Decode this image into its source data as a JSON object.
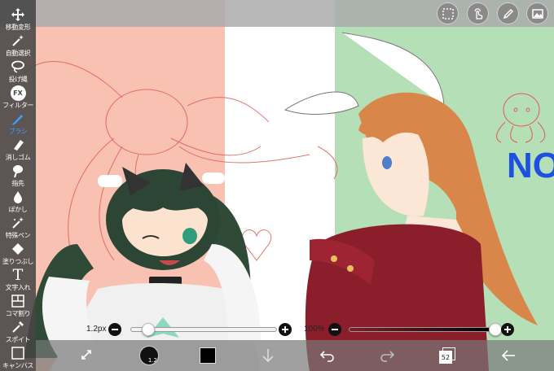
{
  "tools": [
    {
      "label": "移動変形",
      "icon": "move-icon"
    },
    {
      "label": "自動選択",
      "icon": "magic-wand-icon"
    },
    {
      "label": "投げ縄",
      "icon": "lasso-icon"
    },
    {
      "label": "フィルター",
      "icon": "fx-icon",
      "icon_text": "FX"
    },
    {
      "label": "ブラシ",
      "icon": "brush-icon",
      "active": true
    },
    {
      "label": "消しゴム",
      "icon": "eraser-icon"
    },
    {
      "label": "指先",
      "icon": "smudge-icon"
    },
    {
      "label": "ぼかし",
      "icon": "blur-drop-icon"
    },
    {
      "label": "特殊ペン",
      "icon": "special-pen-icon"
    },
    {
      "label": "塗りつぶし",
      "icon": "fill-bucket-icon"
    },
    {
      "label": "文字入れ",
      "icon": "text-icon",
      "icon_text": "T"
    },
    {
      "label": "コマ割り",
      "icon": "frame-divider-icon"
    },
    {
      "label": "スポイト",
      "icon": "eyedropper-icon"
    },
    {
      "label": "キャンバス",
      "icon": "canvas-icon"
    }
  ],
  "top_buttons": [
    "selection-icon",
    "gesture-icon",
    "pen-icon",
    "gallery-icon"
  ],
  "brush_size": {
    "value": 0.12,
    "label": "1.2px"
  },
  "opacity": {
    "value": 1.0,
    "label": "100%"
  },
  "bottom": {
    "brush_badge": "1.2",
    "layer_count": "52",
    "brush_color": "#000000"
  },
  "canvas_text": "NO",
  "colors": {
    "accent": "#3aa0ff",
    "panel": "#464646",
    "flag_red": "#f9c1b2",
    "flag_green": "#b5dfb6",
    "text_blue": "#1d52e0"
  }
}
